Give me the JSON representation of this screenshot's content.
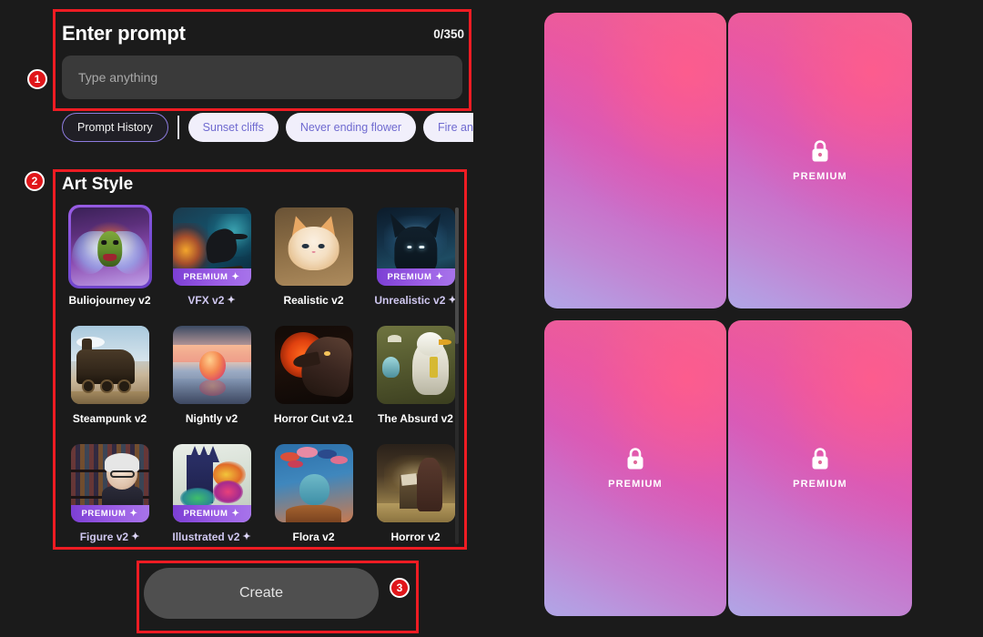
{
  "prompt": {
    "title": "Enter prompt",
    "counter": "0/350",
    "placeholder": "Type anything",
    "value": ""
  },
  "chips": {
    "history_label": "Prompt History",
    "items": [
      "Sunset cliffs",
      "Never ending flower",
      "Fire and w"
    ]
  },
  "art_style": {
    "title": "Art Style",
    "premium_badge_label": "PREMIUM",
    "items": [
      {
        "label": "Buliojourney v2",
        "premium": false,
        "selected": true,
        "sparkle": false,
        "art": "t-bulio"
      },
      {
        "label": "VFX v2",
        "premium": true,
        "selected": false,
        "sparkle": true,
        "art": "t-vfx"
      },
      {
        "label": "Realistic v2",
        "premium": false,
        "selected": false,
        "sparkle": false,
        "art": "t-real"
      },
      {
        "label": "Unrealistic v2",
        "premium": true,
        "selected": false,
        "sparkle": true,
        "art": "t-unreal"
      },
      {
        "label": "Steampunk v2",
        "premium": false,
        "selected": false,
        "sparkle": false,
        "art": "t-steam"
      },
      {
        "label": "Nightly v2",
        "premium": false,
        "selected": false,
        "sparkle": false,
        "art": "t-night"
      },
      {
        "label": "Horror Cut v2.1",
        "premium": false,
        "selected": false,
        "sparkle": false,
        "art": "t-horror"
      },
      {
        "label": "The Absurd v2",
        "premium": false,
        "selected": false,
        "sparkle": false,
        "art": "t-absurd"
      },
      {
        "label": "Figure v2",
        "premium": true,
        "selected": false,
        "sparkle": true,
        "art": "t-figure"
      },
      {
        "label": "Illustrated v2",
        "premium": true,
        "selected": false,
        "sparkle": true,
        "art": "t-illus"
      },
      {
        "label": "Flora v2",
        "premium": false,
        "selected": false,
        "sparkle": false,
        "art": "t-flora"
      },
      {
        "label": "Horror v2",
        "premium": false,
        "selected": false,
        "sparkle": false,
        "art": "t-horr2"
      }
    ]
  },
  "create": {
    "label": "Create"
  },
  "steps": {
    "one": "1",
    "two": "2",
    "three": "3"
  },
  "results": {
    "premium_label": "PREMIUM",
    "cards": [
      {
        "locked": false
      },
      {
        "locked": true
      },
      {
        "locked": true
      },
      {
        "locked": true
      }
    ]
  },
  "colors": {
    "background": "#1b1b1b",
    "annotation_red": "#ee1c23",
    "step_marker": "#e0161a",
    "accent_purple": "#8e7ce0",
    "premium_badge": "#9b5de5",
    "chip_bg": "#f1effb",
    "chip_text": "#6f6ad0",
    "input_bg": "#3a3a3a",
    "create_bg": "#4f4f4f",
    "card_pink": "#ef5f93",
    "card_lavender": "#b0a6e6"
  }
}
